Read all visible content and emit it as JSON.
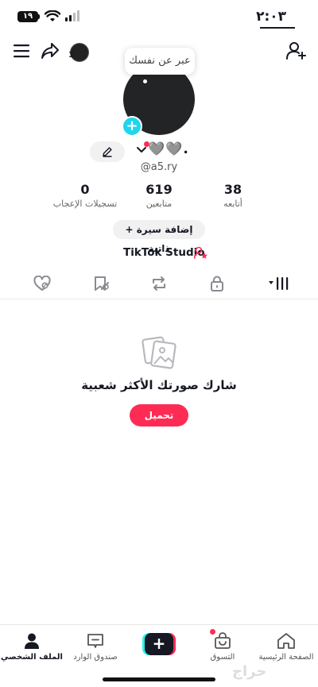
{
  "status_bar": {
    "time": "٢:٠٣",
    "battery": "١٩"
  },
  "top_nav": {
    "story_count": "1",
    "bio_prompt": "عبر عن نفسك"
  },
  "profile": {
    "display_name": "🩶🩶.",
    "username": "@a5.ry",
    "stats": [
      {
        "value": "38",
        "label": "أتابعه"
      },
      {
        "value": "619",
        "label": "متابعين"
      },
      {
        "value": "0",
        "label": "تسجيلات الإعجاب"
      }
    ],
    "add_bio_label": "+ إضافة سيرة ذاتية",
    "studio_label": "TikTok Studio"
  },
  "empty_state": {
    "title": "شارك صورتك الأكثر شعبية",
    "upload_label": "تحميل"
  },
  "bottom_nav": {
    "home": "الصفحة الرئيسية",
    "shop": "التسوق",
    "inbox": "صندوق الوارد",
    "profile": "الملف الشخصي"
  },
  "watermark": "حراج",
  "colors": {
    "accent": "#fe2c55",
    "cyan": "#25f4ee",
    "add_avatar": "#20d5ec",
    "text": "#161823"
  },
  "icons": [
    "menu-icon",
    "share-icon",
    "add-user-icon",
    "pencil-icon",
    "chevron-down-icon",
    "grid-icon",
    "lock-icon",
    "repost-icon",
    "favorites-icon",
    "liked-icon",
    "photo-icon",
    "home-icon",
    "shop-icon",
    "inbox-icon",
    "profile-icon"
  ]
}
